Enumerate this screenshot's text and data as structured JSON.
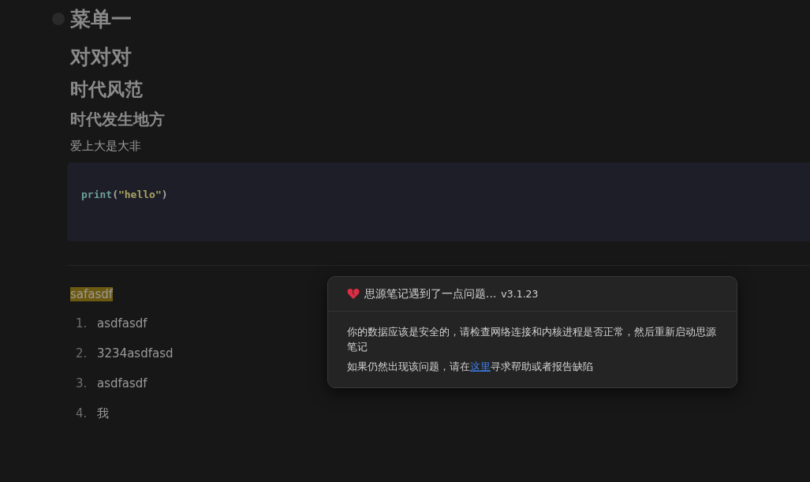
{
  "headings": [
    {
      "kind": "h1",
      "text": "菜单一"
    },
    {
      "kind": "h2",
      "text": "对对对"
    },
    {
      "kind": "h3",
      "text": "时代风范"
    },
    {
      "kind": "h4",
      "text": "时代发生地方"
    }
  ],
  "paragraph": "爱上大是大非",
  "code": {
    "func": "print",
    "open": "(",
    "string": "\"hello\"",
    "close": ")"
  },
  "highlight": "safasdf",
  "list": [
    {
      "number": "1.",
      "text": "asdfasdf"
    },
    {
      "number": "2.",
      "text": "3234asdfasd"
    },
    {
      "number": "3.",
      "text": "asdfasdf"
    },
    {
      "number": "4.",
      "text": "我"
    }
  ],
  "dialog": {
    "title": "思源笔记遇到了一点问题...",
    "version": "v3.1.23",
    "message": "你的数据应该是安全的，请检查网络连接和内核进程是否正常，然后重新启动思源笔记",
    "help_before": "如果仍然出现该问题，请在",
    "help_link": "这里",
    "help_after": "寻求帮助或者报告缺陷"
  }
}
